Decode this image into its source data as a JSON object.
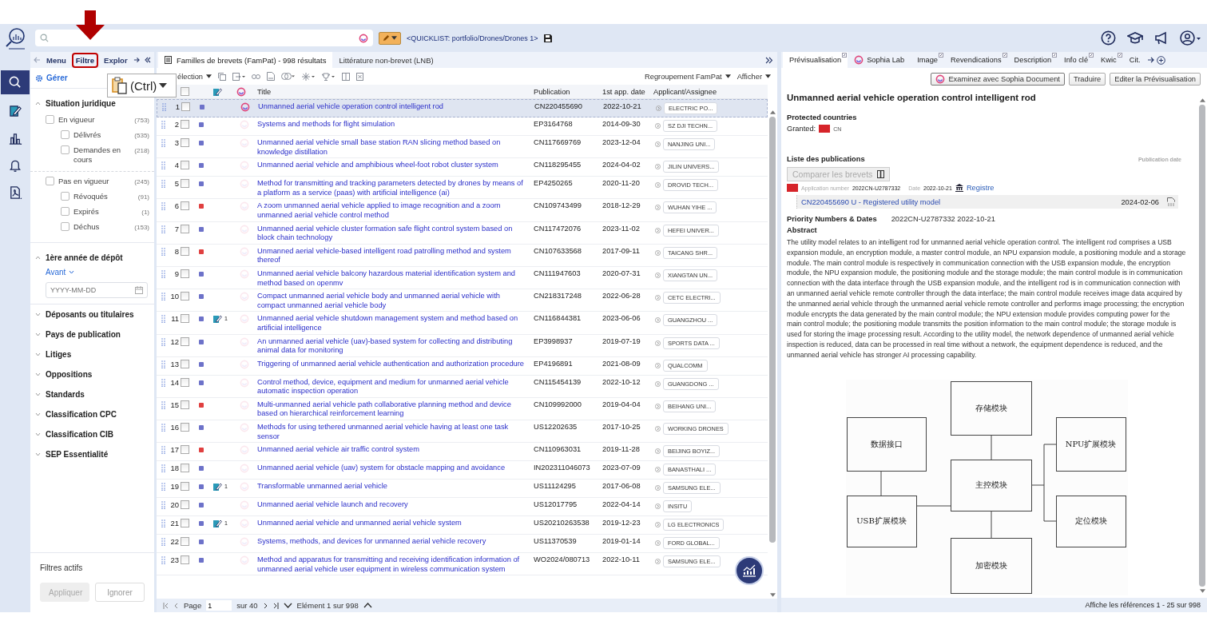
{
  "app_bar": {
    "quicklist": "<QUICKLIST: portfolio/Drones/Drones 1>"
  },
  "rail": [
    {
      "kind": "search",
      "selected": true
    },
    {
      "kind": "notebook",
      "selected": false
    },
    {
      "kind": "chart",
      "selected": false
    },
    {
      "kind": "bell",
      "selected": false
    },
    {
      "kind": "pdf",
      "selected": false
    }
  ],
  "left_tabs": [
    {
      "label": "Menu",
      "selected": false,
      "highlighted": false
    },
    {
      "label": "Filtre",
      "selected": true,
      "highlighted": true
    },
    {
      "label": "Explor",
      "selected": false,
      "highlighted": false
    }
  ],
  "paste_popup": {
    "label": "(Ctrl)"
  },
  "filters": {
    "manage": "Gérer",
    "sections": [
      {
        "title": "Situation juridique",
        "expanded": true,
        "kind": "checklist",
        "groups": [
          {
            "label": "En vigueur",
            "count": "(753)",
            "checked": false,
            "children": [
              {
                "label": "Délivrés",
                "count": "(535)",
                "checked": false
              },
              {
                "label": "Demandes en cours",
                "count": "(218)",
                "checked": false
              }
            ]
          },
          {
            "label": "Pas en vigueur",
            "count": "(245)",
            "checked": false,
            "children": [
              {
                "label": "Révoqués",
                "count": "(91)",
                "checked": false
              },
              {
                "label": "Expirés",
                "count": "(1)",
                "checked": false
              },
              {
                "label": "Déchus",
                "count": "(153)",
                "checked": false
              }
            ]
          }
        ]
      },
      {
        "title": "1ère année de dépôt",
        "expanded": true,
        "kind": "date",
        "mode": "Avant",
        "placeholder": "YYYY-MM-DD"
      },
      {
        "title": "Déposants ou titulaires",
        "expanded": false
      },
      {
        "title": "Pays de publication",
        "expanded": false
      },
      {
        "title": "Litiges",
        "expanded": false
      },
      {
        "title": "Oppositions",
        "expanded": false
      },
      {
        "title": "Standards",
        "expanded": false
      },
      {
        "title": "Classification CPC",
        "expanded": false
      },
      {
        "title": "Classification CIB",
        "expanded": false
      },
      {
        "title": "SEP Essentialité",
        "expanded": false
      }
    ],
    "active_title": "Filtres actifs",
    "buttons": [
      {
        "label": "Appliquer",
        "disabled": true
      },
      {
        "label": "Ignorer",
        "disabled": false
      }
    ]
  },
  "results": {
    "tabs": [
      {
        "label": "Familles de brevets (FamPat) - 998 résultats",
        "selected": true
      },
      {
        "label": "Littérature non-brevet (LNB)",
        "selected": false
      }
    ],
    "selection": "élection",
    "all_selected": false,
    "grouping": "Regroupement FamPat",
    "display": "Afficher",
    "columns": [
      "Title",
      "Publication",
      "1st app. date",
      "Applicant/Assignee"
    ],
    "rows": [
      {
        "num": "1",
        "selected": true,
        "color": "#6d72c9",
        "sophia": true,
        "title": "Unmanned aerial vehicle operation control intelligent rod",
        "publication": "CN220455690",
        "date": "2022-10-21",
        "applicant": "ELECTRIC PO..."
      },
      {
        "num": "2",
        "selected": false,
        "color": "#6d72c9",
        "sophia": false,
        "title": "Systems and methods for flight simulation",
        "publication": "EP3164768",
        "date": "2014-09-30",
        "applicant": "SZ DJI TECHN..."
      },
      {
        "num": "3",
        "selected": false,
        "color": "#6d72c9",
        "sophia": false,
        "title": "Unmanned aerial vehicle small base station RAN slicing method based on knowledge distillation",
        "publication": "CN117669769",
        "date": "2023-12-04",
        "applicant": "NANJING UNI..."
      },
      {
        "num": "4",
        "selected": false,
        "color": "#6d72c9",
        "sophia": false,
        "title": "Unmanned aerial vehicle and amphibious wheel-foot robot cluster system",
        "publication": "CN118295455",
        "date": "2024-04-02",
        "applicant": "JILIN UNIVERS..."
      },
      {
        "num": "5",
        "selected": false,
        "color": "#6d72c9",
        "sophia": false,
        "title": "Method for transmitting and tracking parameters detected by drones by means of a platform as a service (paas) with artificial intelligence (ai)",
        "publication": "EP4250265",
        "date": "2020-11-20",
        "applicant": "DROVID TECH..."
      },
      {
        "num": "6",
        "selected": false,
        "color": "#e04040",
        "sophia": false,
        "title": "A zoom unmanned aerial vehicle applied to image recognition and a zoom unmanned aerial vehicle control method",
        "publication": "CN109743499",
        "date": "2018-12-29",
        "applicant": "WUHAN YIHE ..."
      },
      {
        "num": "7",
        "selected": false,
        "color": "#6d72c9",
        "sophia": false,
        "title": "Unmanned aerial vehicle cluster formation safe flight control system based on block chain technology",
        "publication": "CN117472076",
        "date": "2023-11-02",
        "applicant": "HEFEI UNIVER..."
      },
      {
        "num": "8",
        "selected": false,
        "color": "#e04040",
        "sophia": false,
        "title": "Unmanned aerial vehicle-based intelligent road patrolling method and system thereof",
        "publication": "CN107633568",
        "date": "2017-09-11",
        "applicant": "TAICANG SHR..."
      },
      {
        "num": "9",
        "selected": false,
        "color": "#6d72c9",
        "sophia": false,
        "title": "Unmanned aerial vehicle balcony hazardous material identification system and method based on openmv",
        "publication": "CN111947603",
        "date": "2020-07-31",
        "applicant": "XIANGTAN UN..."
      },
      {
        "num": "10",
        "selected": false,
        "color": "#6d72c9",
        "sophia": false,
        "title": "Compact unmanned aerial vehicle body and unmanned aerial vehicle with compact unmanned aerial vehicle body",
        "publication": "CN218317248",
        "date": "2022-06-28",
        "applicant": "CETC ELECTRI..."
      },
      {
        "num": "11",
        "selected": false,
        "color": "#6d72c9",
        "sophia": false,
        "notes": "1",
        "title": "Unmanned aerial vehicle shutdown management system and method based on artificial intelligence",
        "publication": "CN116844381",
        "date": "2023-06-06",
        "applicant": "GUANGZHOU ..."
      },
      {
        "num": "12",
        "selected": false,
        "color": "#6d72c9",
        "sophia": false,
        "title": "An unmanned aerial vehicle (uav)-based system for collecting and distributing animal data for monitoring",
        "publication": "EP3998937",
        "date": "2019-07-19",
        "applicant": "SPORTS DATA ..."
      },
      {
        "num": "13",
        "selected": false,
        "color": "#6d72c9",
        "sophia": false,
        "title": "Triggering of unmanned aerial vehicle authentication and authorization procedure",
        "publication": "EP4196891",
        "date": "2021-08-09",
        "applicant": "QUALCOMM"
      },
      {
        "num": "14",
        "selected": false,
        "color": "#6d72c9",
        "sophia": false,
        "title": "Control method, device, equipment and medium for unmanned aerial vehicle automatic inspection operation",
        "publication": "CN115454139",
        "date": "2022-10-12",
        "applicant": "GUANGDONG ..."
      },
      {
        "num": "15",
        "selected": false,
        "color": "#e04040",
        "sophia": false,
        "title": "Multi-unmanned aerial vehicle path collaborative planning method and device based on hierarchical reinforcement learning",
        "publication": "CN109992000",
        "date": "2019-04-04",
        "applicant": "BEIHANG UNI..."
      },
      {
        "num": "16",
        "selected": false,
        "color": "#6d72c9",
        "sophia": false,
        "title": "Methods for using tethered unmanned aerial vehicle having at least one task sensor",
        "publication": "US12202635",
        "date": "2017-10-25",
        "applicant": "WORKING DRONES"
      },
      {
        "num": "17",
        "selected": false,
        "color": "#e04040",
        "sophia": false,
        "title": "Unmanned aerial vehicle air traffic control system",
        "publication": "CN110963031",
        "date": "2019-11-28",
        "applicant": "BEIJING BOYIZ..."
      },
      {
        "num": "18",
        "selected": false,
        "color": "#6d72c9",
        "sophia": false,
        "title": "Unmanned aerial vehicle (uav) system for obstacle mapping and avoidance",
        "publication": "IN202311046073",
        "date": "2023-07-09",
        "applicant": "BANASTHALI ..."
      },
      {
        "num": "19",
        "selected": false,
        "color": "#6d72c9",
        "sophia": false,
        "notes": "1",
        "title": "Transformable unmanned aerial vehicle",
        "publication": "US11124295",
        "date": "2017-06-08",
        "applicant": "SAMSUNG ELE..."
      },
      {
        "num": "20",
        "selected": false,
        "color": "#6d72c9",
        "sophia": false,
        "title": "Unmanned aerial vehicle launch and recovery",
        "publication": "US12017795",
        "date": "2022-04-14",
        "applicant": "INSITU"
      },
      {
        "num": "21",
        "selected": false,
        "color": "#6d72c9",
        "sophia": false,
        "notes": "1",
        "title": "Unmanned aerial vehicle and unmanned aerial vehicle system",
        "publication": "US20210263538",
        "date": "2019-12-23",
        "applicant": "LG ELECTRONICS"
      },
      {
        "num": "22",
        "selected": false,
        "color": "#6d72c9",
        "sophia": false,
        "title": "Systems, methods, and devices for unmanned aerial vehicle recovery",
        "publication": "US11370539",
        "date": "2019-01-14",
        "applicant": "FORD GLOBAL..."
      },
      {
        "num": "23",
        "selected": false,
        "color": "#6d72c9",
        "sophia": false,
        "title": "Method and apparatus for transmitting and receiving identification information of unmanned aerial vehicle user equipment in wireless communication system",
        "publication": "WO2024/080713",
        "date": "2022-10-11",
        "applicant": "SAMSUNG ELE..."
      }
    ],
    "pager": {
      "page_label": "Page",
      "page": "1",
      "total": "sur 40",
      "element": "Elément 1 sur 998"
    }
  },
  "preview": {
    "tabs": [
      {
        "label": "Prévisualisation",
        "selected": true
      },
      {
        "label": "Sophia Lab",
        "selected": false
      },
      {
        "label": "Image",
        "selected": false
      },
      {
        "label": "Revendications",
        "selected": false
      },
      {
        "label": "Description",
        "selected": false
      },
      {
        "label": "Info clé",
        "selected": false
      },
      {
        "label": "Kwic",
        "selected": false
      },
      {
        "label": "Cit.",
        "selected": false
      }
    ],
    "actions": [
      "Examinez avec Sophia Document",
      "Traduire",
      "Editer la Prévisualisation"
    ],
    "title": "Unmanned aerial vehicle operation control intelligent rod",
    "protected_heading": "Protected countries",
    "granted_label": "Granted:",
    "granted_country": "CN",
    "publications_heading": "Liste des publications",
    "publication_date_label": "Publication date",
    "compare": "Comparer les brevets",
    "application_label": "Application number",
    "application_number": "2022CN-U2787332",
    "date_label": "Date",
    "date": "2022-10-21",
    "register": "Registre",
    "publication": {
      "title": "CN220455690 U - Registered utility model",
      "date": "2024-02-06"
    },
    "priority_label": "Priority Numbers & Dates",
    "priority": "2022CN-U2787332 2022-10-21",
    "abstract_heading": "Abstract",
    "abstract": "The utility model relates to an intelligent rod for unmanned aerial vehicle operation control. The intelligent rod comprises a USB expansion module, an encryption module, a master control module, an NPU expansion module, a positioning module and a storage module. The main control module is respectively in communication connection with the USB expansion module, the encryption module, the NPU expansion module, the positioning module and the storage module; the main control module is in communication connection with the data interface through the USB expansion module, and the intelligent rod is in communication connection with an unmanned aerial vehicle remote controller through the data interface; the main control module receives image data acquired by the unmanned aerial vehicle through the unmanned aerial vehicle remote controller and performs image processing; the encryption module encrypts the data generated by the main control module; the NPU extension module provides computing power for the main control module; the positioning module transmits the position information to the main control module; the storage module is used for storing the image processing result. According to the utility model, the network dependence of unmanned aerial vehicle inspection is reduced, data can be processed in real time without a network, the equipment dependence is reduced, and the unmanned aerial vehicle has stronger AI processing capability.",
    "figure": {
      "nodes": [
        "存储模块",
        "数据接口",
        "NPU扩展模块",
        "主控模块",
        "USB扩展模块",
        "定位模块",
        "加密模块"
      ]
    }
  },
  "status": "Affiche les références 1 - 25 sur 998"
}
